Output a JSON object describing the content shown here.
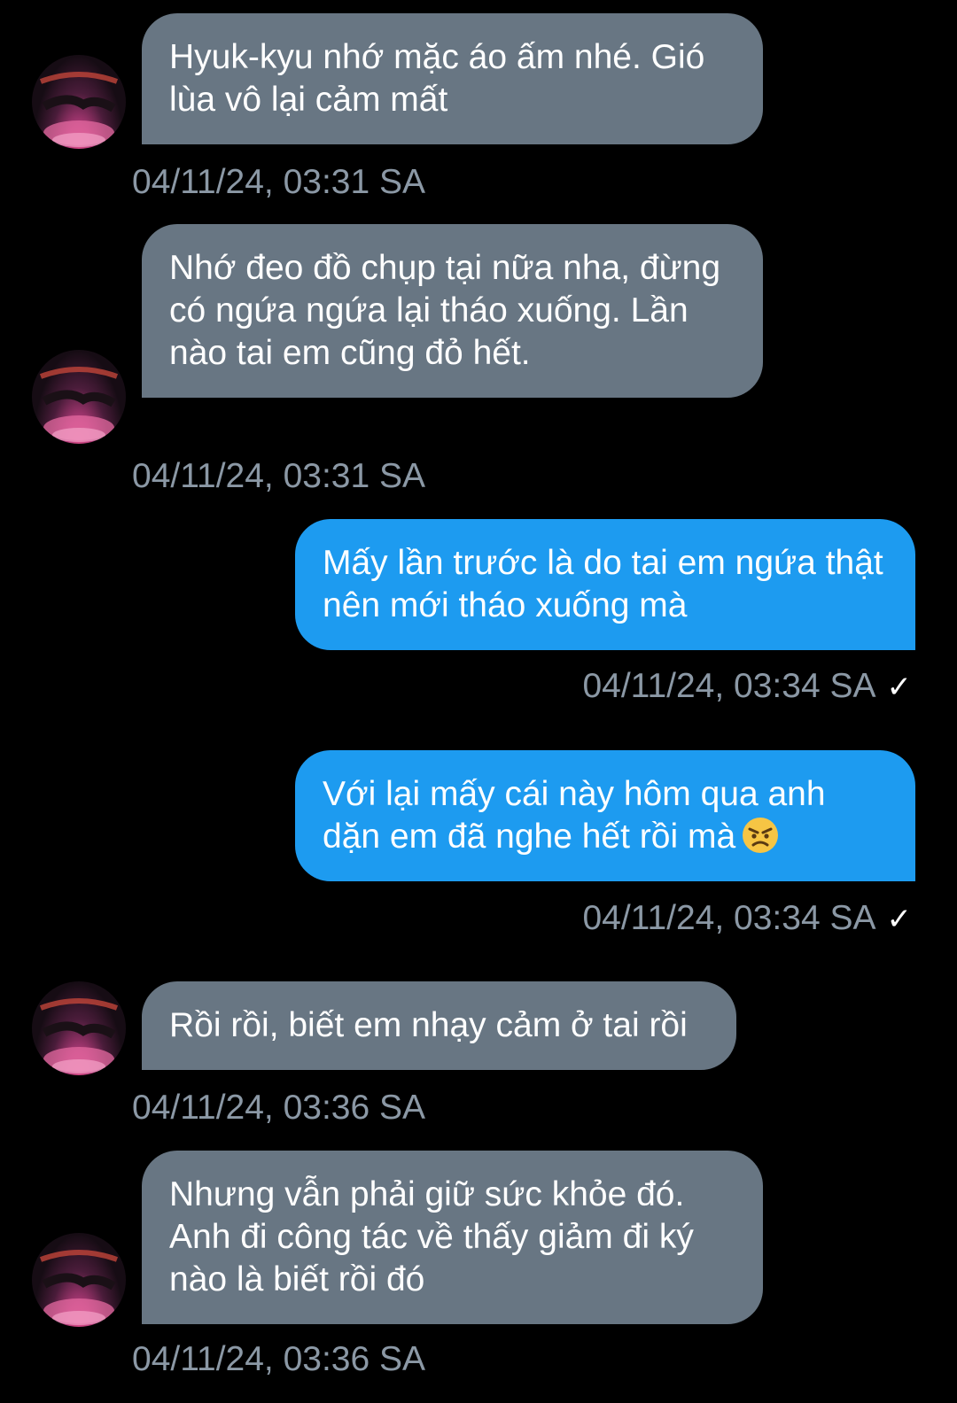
{
  "colors": {
    "background": "#000000",
    "received_bubble": "#687683",
    "sent_bubble": "#1d9bf0",
    "timestamp": "#8b98a5"
  },
  "messages": [
    {
      "direction": "received",
      "text": "Hyuk-kyu nhớ mặc áo ấm nhé. Gió lùa vô lại cảm mất",
      "time": "04/11/24, 03:31 SA"
    },
    {
      "direction": "received",
      "text": "Nhớ đeo đồ chụp tại nữa nha, đừng có ngứa ngứa lại tháo xuống. Lần nào tai em cũng đỏ hết.",
      "time": "04/11/24, 03:31 SA"
    },
    {
      "direction": "sent",
      "text": "Mấy lần trước là do tai em ngứa thật nên mới tháo xuống mà",
      "time": "04/11/24, 03:34 SA",
      "status_icon": "check-icon"
    },
    {
      "direction": "sent",
      "text": "Với lại mấy cái này hôm qua anh dặn em đã nghe hết rồi mà",
      "emoji": "angry-face-icon",
      "time": "04/11/24, 03:34 SA",
      "status_icon": "check-icon"
    },
    {
      "direction": "received",
      "text": "Rồi rồi, biết em nhạy cảm ở tai rồi",
      "time": "04/11/24, 03:36 SA"
    },
    {
      "direction": "received",
      "text": "Nhưng vẫn phải giữ sức khỏe đó. Anh đi công tác về thấy giảm đi ký nào là biết rồi đó",
      "time": "04/11/24, 03:36 SA"
    }
  ]
}
